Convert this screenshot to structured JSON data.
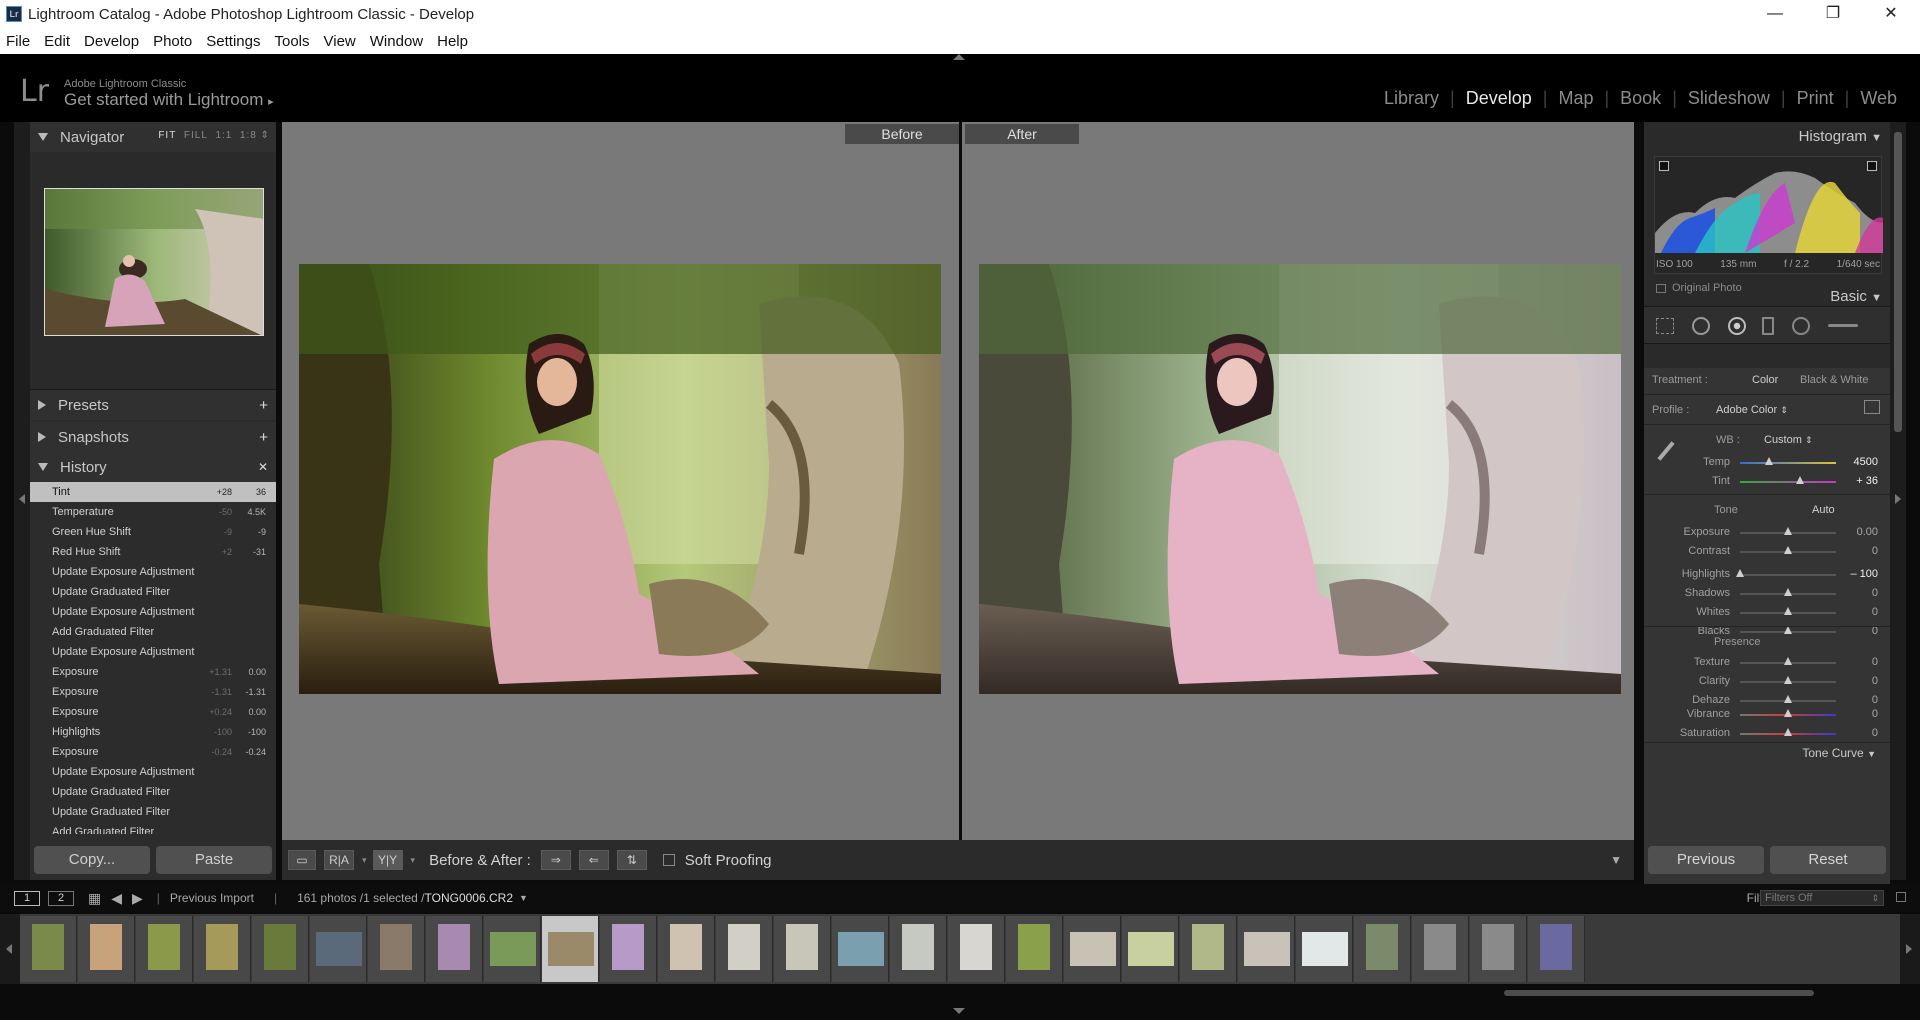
{
  "window": {
    "title": "Lightroom Catalog - Adobe Photoshop Lightroom Classic - Develop",
    "icon_text": "Lr",
    "controls": [
      "—",
      "❐",
      "✕"
    ]
  },
  "menu": [
    "File",
    "Edit",
    "Develop",
    "Photo",
    "Settings",
    "Tools",
    "View",
    "Window",
    "Help"
  ],
  "identity": {
    "logo": "Lr",
    "product": "Adobe Lightroom Classic",
    "tagline": "Get started with Lightroom",
    "tagline_arrow": "▸"
  },
  "modules": [
    "Library",
    "Develop",
    "Map",
    "Book",
    "Slideshow",
    "Print",
    "Web"
  ],
  "active_module": "Develop",
  "left": {
    "navigator": {
      "title": "Navigator",
      "fit": "FIT",
      "fill": "FILL",
      "one": "1:1",
      "ratio": "1:8"
    },
    "presets": {
      "title": "Presets",
      "add": "+"
    },
    "snapshots": {
      "title": "Snapshots",
      "add": "+"
    },
    "history": {
      "title": "History",
      "close": "✕"
    },
    "history_items": [
      {
        "name": "Tint",
        "from": "+28",
        "to": "36"
      },
      {
        "name": "Temperature",
        "from": "-50",
        "to": "4.5K"
      },
      {
        "name": "Green Hue Shift",
        "from": "-9",
        "to": "-9"
      },
      {
        "name": "Red Hue Shift",
        "from": "+2",
        "to": "-31"
      },
      {
        "name": "Update Exposure Adjustment",
        "from": "",
        "to": ""
      },
      {
        "name": "Update Graduated Filter",
        "from": "",
        "to": ""
      },
      {
        "name": "Update Exposure Adjustment",
        "from": "",
        "to": ""
      },
      {
        "name": "Add Graduated Filter",
        "from": "",
        "to": ""
      },
      {
        "name": "Update Exposure Adjustment",
        "from": "",
        "to": ""
      },
      {
        "name": "Exposure",
        "from": "+1.31",
        "to": "0.00"
      },
      {
        "name": "Exposure",
        "from": "-1.31",
        "to": "-1.31"
      },
      {
        "name": "Exposure",
        "from": "+0.24",
        "to": "0.00"
      },
      {
        "name": "Highlights",
        "from": "-100",
        "to": "-100"
      },
      {
        "name": "Exposure",
        "from": "-0.24",
        "to": "-0.24"
      },
      {
        "name": "Update Exposure Adjustment",
        "from": "",
        "to": ""
      },
      {
        "name": "Update Graduated Filter",
        "from": "",
        "to": ""
      },
      {
        "name": "Update Graduated Filter",
        "from": "",
        "to": ""
      },
      {
        "name": "Add Graduated Filter",
        "from": "",
        "to": ""
      }
    ],
    "copy_btn": "Copy...",
    "paste_btn": "Paste"
  },
  "center": {
    "before_label": "Before",
    "after_label": "After"
  },
  "toolbar": {
    "ra_label": "R|A",
    "yy_label": "Y|Y",
    "before_after_label": "Before & After :",
    "soft_proofing": "Soft Proofing"
  },
  "right": {
    "histogram_title": "Histogram",
    "exif": {
      "iso": "ISO 100",
      "focal": "135 mm",
      "aperture": "f / 2.2",
      "shutter": "1/640 sec"
    },
    "original_photo": "Original Photo",
    "basic_title": "Basic",
    "treatment_label": "Treatment :",
    "treatment_color": "Color",
    "treatment_bw": "Black & White",
    "profile_label": "Profile :",
    "profile_value": "Adobe Color",
    "wb_label": "WB :",
    "wb_value": "Custom",
    "tone_label": "Tone",
    "auto_label": "Auto",
    "presence_label": "Presence",
    "tone_curve_label": "Tone Curve",
    "wb_sliders": [
      {
        "name": "Temp",
        "value": "4500",
        "pos": 0.3,
        "strong": true
      },
      {
        "name": "Tint",
        "value": "+ 36",
        "pos": 0.62,
        "strong": true
      }
    ],
    "tone_sliders": [
      {
        "name": "Exposure",
        "value": "0.00",
        "pos": 0.5
      },
      {
        "name": "Contrast",
        "value": "0",
        "pos": 0.5
      }
    ],
    "tone_sliders2": [
      {
        "name": "Highlights",
        "value": "– 100",
        "pos": 0.0,
        "strong": true
      },
      {
        "name": "Shadows",
        "value": "0",
        "pos": 0.5
      },
      {
        "name": "Whites",
        "value": "0",
        "pos": 0.5
      },
      {
        "name": "Blacks",
        "value": "0",
        "pos": 0.5
      }
    ],
    "presence_sliders": [
      {
        "name": "Texture",
        "value": "0",
        "pos": 0.5
      },
      {
        "name": "Clarity",
        "value": "0",
        "pos": 0.5
      },
      {
        "name": "Dehaze",
        "value": "0",
        "pos": 0.5
      }
    ],
    "presence_sliders2": [
      {
        "name": "Vibrance",
        "value": "0",
        "pos": 0.5
      },
      {
        "name": "Saturation",
        "value": "0",
        "pos": 0.5
      }
    ],
    "previous_btn": "Previous",
    "reset_btn": "Reset"
  },
  "filmbar": {
    "page1": "1",
    "page2": "2",
    "source": "Previous Import",
    "count": "161 photos /1 selected /",
    "filename": "TONG0006.CR2",
    "filter_label": "Filter :",
    "filter_value": "Filters Off"
  },
  "colors": {
    "accent_active": "#e8e8e8",
    "panel_bg": "#2c2c2c",
    "center_bg": "#797979"
  }
}
